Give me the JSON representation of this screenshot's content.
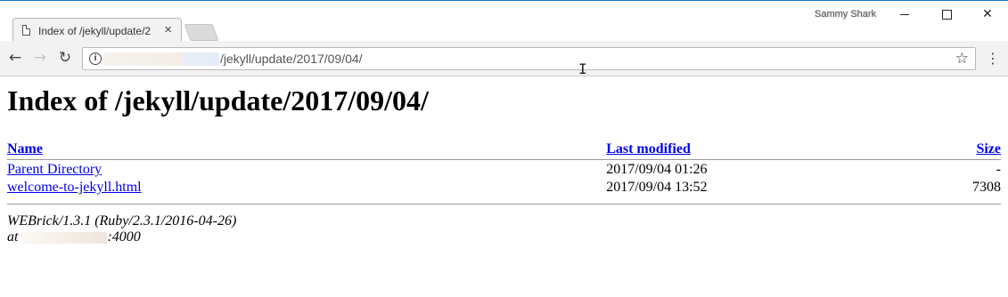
{
  "browser": {
    "tab_title": "Index of /jekyll/update/2",
    "tab_close": "×",
    "profile_name": "Sammy Shark",
    "address": "/jekyll/update/2017/09/04/",
    "window_controls": {
      "close": "✕"
    }
  },
  "icons": {
    "back": "←",
    "forward": "→",
    "reload": "↻",
    "info": "i",
    "star": "☆",
    "menu": "⋮",
    "cursor": "I"
  },
  "page": {
    "heading": "Index of /jekyll/update/2017/09/04/",
    "columns": {
      "name": "Name",
      "modified": "Last modified",
      "size": "Size"
    },
    "rows": [
      {
        "name": "Parent Directory",
        "modified": "2017/09/04 01:26",
        "size": "-"
      },
      {
        "name": "welcome-to-jekyll.html",
        "modified": "2017/09/04 13:52",
        "size": "7308"
      }
    ],
    "footer": {
      "server": "WEBrick/1.3.1 (Ruby/2.3.1/2016-04-26)",
      "at_prefix": "at",
      "port": ":4000"
    }
  },
  "colors": {
    "link": "#0000ee",
    "window_accent": "#1979ca"
  }
}
